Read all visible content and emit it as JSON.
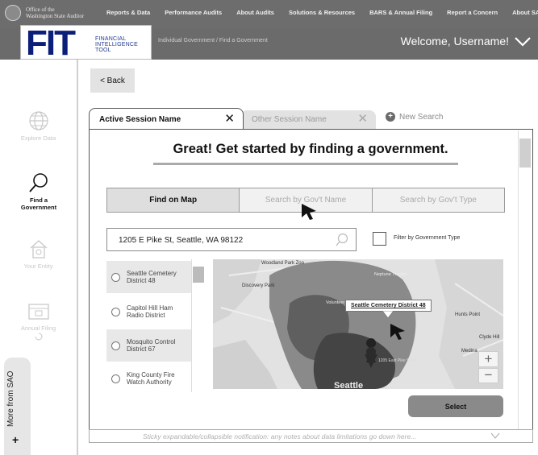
{
  "topnav": {
    "org_line1": "Office of the",
    "org_line2": "Washington State Auditor",
    "menu": [
      "Reports & Data",
      "Performance Audits",
      "About Audits",
      "Solutions & Resources",
      "BARS & Annual Filing",
      "Report a Concern",
      "About SAO"
    ]
  },
  "header": {
    "logo_mark": "FIT",
    "logo_sub": [
      "FINANCIAL",
      "INTELLIGENCE",
      "TOOL"
    ],
    "breadcrumb": "Individual Government / Find a Government",
    "welcome": "Welcome, Username!"
  },
  "sidebar": {
    "items": [
      {
        "label": "Explore Data",
        "icon": "globe-icon",
        "active": false
      },
      {
        "label": "Find a Government",
        "icon": "magnifier-icon",
        "active": true
      },
      {
        "label": "Your Entity",
        "icon": "home-icon",
        "active": false
      },
      {
        "label": "Annual Filing",
        "icon": "filing-icon",
        "active": false
      }
    ],
    "more_label": "More from SAO",
    "more_plus": "+"
  },
  "content": {
    "back_label": "< Back",
    "tabs": {
      "active": "Active Session Name",
      "other": "Other Session Name",
      "close_glyph": "✕",
      "new_search": "New Search"
    },
    "headline": "Great! Get started by finding a government.",
    "segments": [
      "Find on Map",
      "Search by Gov't Name",
      "Search by Gov't Type"
    ],
    "address": "1205 E Pike St, Seattle, WA 98122",
    "filter_label": "Filter by Government Type",
    "results": [
      "Seattle Cemetery District 48",
      "Capitol Hill Ham Radio District",
      "Mosquito Control District 67",
      "King County Fire Watch Authority"
    ],
    "map": {
      "callout": "Seattle Cemetery District 48",
      "labels": [
        "Woodland Park Zoo",
        "Discovery Park",
        "Neptune Theatre",
        "Volunteer Park",
        "Seattle",
        "Hunts Point",
        "Clyde Hill",
        "Medina",
        "1205 East Pike Street"
      ],
      "zoom_in": "+",
      "zoom_out": "−"
    },
    "select_label": "Select",
    "sticky_note": "Sticky expandable/collapsible notification: any notes about data limitations go down here..."
  },
  "colors": {
    "nav_bg": "#6d6d6d",
    "logo_blue": "#0b1f7a",
    "panel_border": "#555555"
  }
}
